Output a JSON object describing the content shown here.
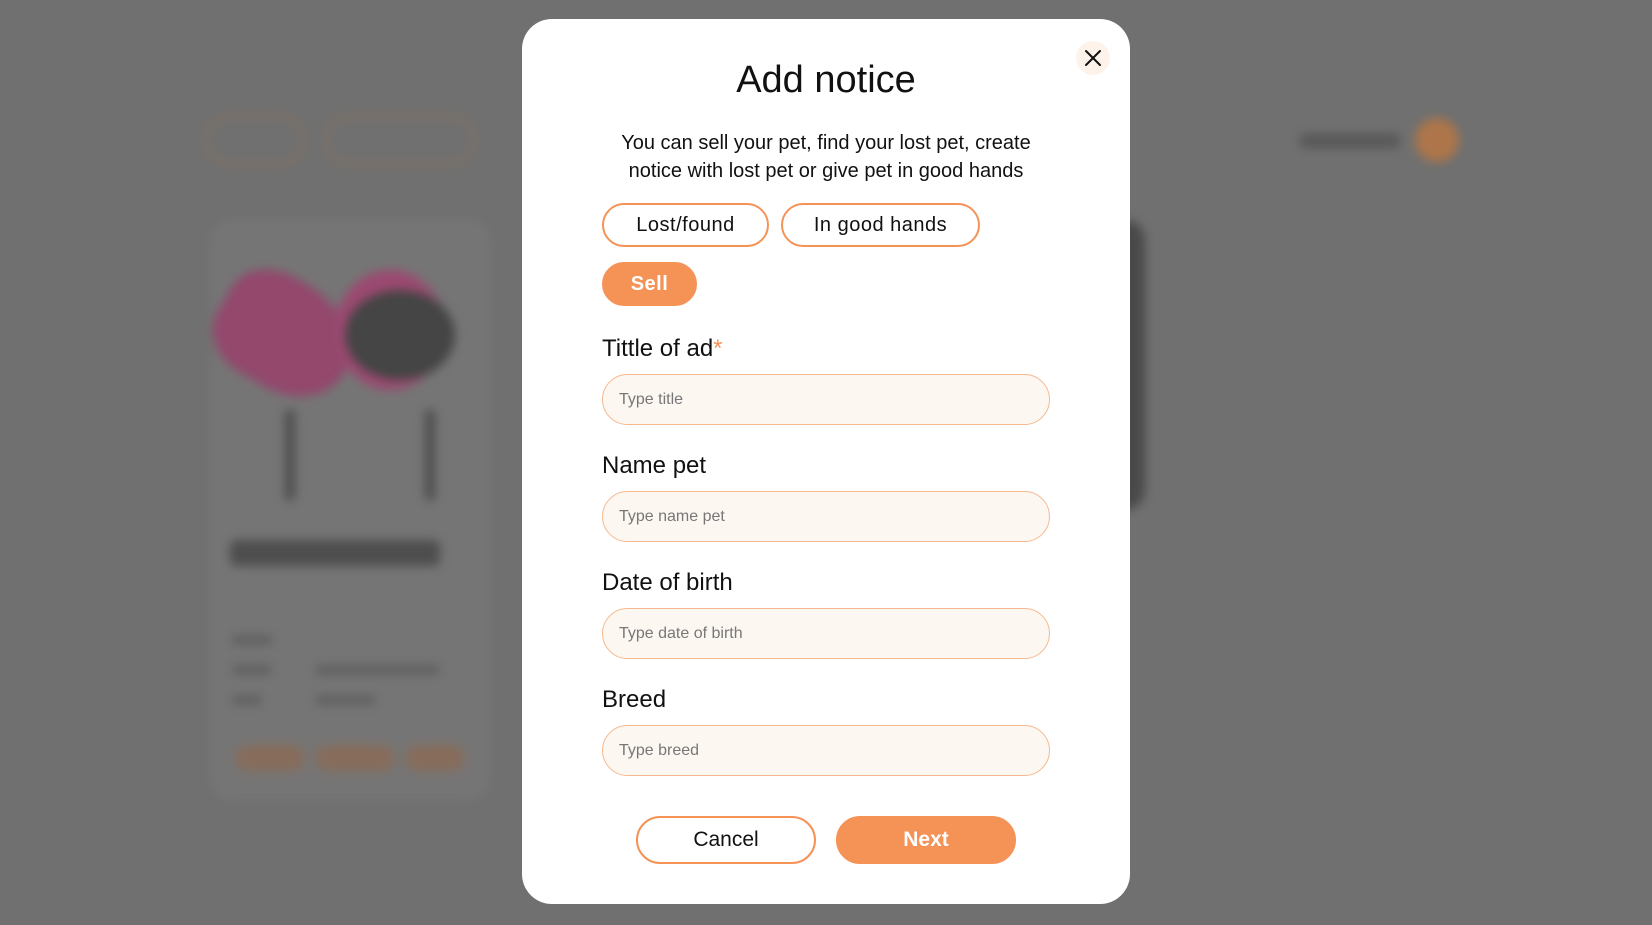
{
  "modal": {
    "title": "Add notice",
    "subtitle": "You can sell your pet, find your lost pet, create notice with lost pet or give pet in good hands",
    "close_icon": "close-icon"
  },
  "categories": [
    {
      "label": "Lost/found",
      "active": false
    },
    {
      "label": "In good hands",
      "active": false
    },
    {
      "label": "Sell",
      "active": true
    }
  ],
  "fields": {
    "title": {
      "label": "Tittle of ad",
      "required_mark": "*",
      "placeholder": "Type title",
      "value": ""
    },
    "name": {
      "label": "Name pet",
      "placeholder": "Type name pet",
      "value": ""
    },
    "birth": {
      "label": "Date of birth",
      "placeholder": "Type date of birth",
      "value": ""
    },
    "breed": {
      "label": "Breed",
      "placeholder": "Type breed",
      "value": ""
    }
  },
  "actions": {
    "cancel": "Cancel",
    "next": "Next"
  },
  "colors": {
    "accent": "#f59256",
    "overlay": "#707070",
    "input_bg": "#fdf7f2"
  }
}
